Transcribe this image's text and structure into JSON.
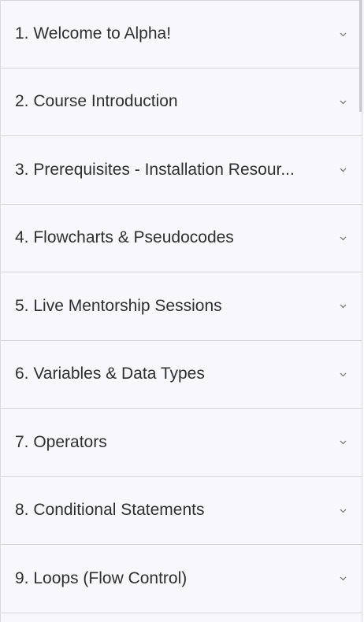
{
  "sections": [
    {
      "label": "1. Welcome to Alpha!",
      "icon": "chevron-down-icon"
    },
    {
      "label": "2. Course Introduction",
      "icon": "chevron-down-icon"
    },
    {
      "label": "3. Prerequisites - Installation Resour...",
      "icon": "chevron-down-icon"
    },
    {
      "label": "4. Flowcharts & Pseudocodes",
      "icon": "chevron-down-icon"
    },
    {
      "label": "5. Live Mentorship Sessions",
      "icon": "chevron-down-icon"
    },
    {
      "label": "6. Variables & Data Types",
      "icon": "chevron-down-icon"
    },
    {
      "label": "7. Operators",
      "icon": "chevron-down-icon"
    },
    {
      "label": "8. Conditional Statements",
      "icon": "chevron-down-icon"
    },
    {
      "label": "9. Loops (Flow Control)",
      "icon": "chevron-down-icon"
    }
  ],
  "colors": {
    "background": "#f8f8fc",
    "text": "#2d2f31",
    "divider": "#d6d6db",
    "chevron": "#6a6f73"
  }
}
